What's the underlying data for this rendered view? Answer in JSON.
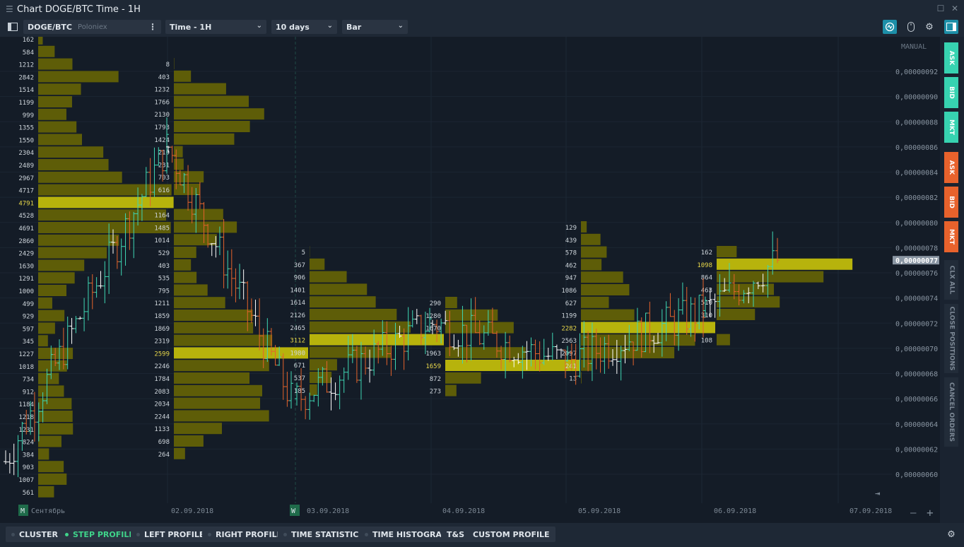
{
  "window": {
    "title": "Chart DOGE/BTC Time - 1H"
  },
  "toolbar": {
    "symbol": "DOGE/BTC",
    "exchange": "Poloniex",
    "timeframe": "Time - 1H",
    "range": "10 days",
    "chart_type": "Bar"
  },
  "price_axis": {
    "mode": "MANUAL",
    "labels": [
      "0,00000092",
      "0,00000090",
      "0,00000088",
      "0,00000086",
      "0,00000084",
      "0,00000082",
      "0,00000080",
      "0,00000078",
      "0,00000076",
      "0,00000074",
      "0,00000072",
      "0,00000070",
      "0,00000068",
      "0,00000066",
      "0,00000064",
      "0,00000062",
      "0,00000060"
    ],
    "current_price": "0,00000077"
  },
  "time_axis": {
    "month_marker": "M",
    "month_label": "Сентябрь",
    "week_marker": "W",
    "dates": [
      "02.09.2018",
      "03.09.2018",
      "04.09.2018",
      "05.09.2018",
      "06.09.2018",
      "07.09.2018"
    ]
  },
  "profiles": [
    {
      "values": [
        "162",
        "584",
        "1212",
        "2842",
        "1514",
        "1199",
        "999",
        "1355",
        "1550",
        "2304",
        "2489",
        "2967",
        "4717",
        "4791",
        "4528",
        "4691",
        "2860",
        "2429",
        "1630",
        "1291",
        "1000",
        "499",
        "929",
        "597",
        "345",
        "1227",
        "1018",
        "734",
        "912",
        "1184",
        "1218",
        "1231",
        "824",
        "384",
        "903",
        "1007",
        "561"
      ],
      "poc": "4791"
    },
    {
      "values": [
        "8",
        "403",
        "1232",
        "1766",
        "2130",
        "1793",
        "1424",
        "210",
        "231",
        "703",
        "616",
        "",
        "1164",
        "1485",
        "1014",
        "529",
        "403",
        "535",
        "795",
        "1211",
        "1859",
        "1869",
        "2319",
        "2599",
        "2246",
        "1784",
        "2083",
        "2034",
        "2244",
        "1133",
        "698",
        "264"
      ],
      "poc": "2599"
    },
    {
      "values": [
        "5",
        "367",
        "906",
        "1401",
        "1614",
        "2126",
        "2465",
        "3112",
        "1980",
        "671",
        "537",
        "185"
      ],
      "poc": "3112"
    },
    {
      "values": [
        "290",
        "1280",
        "1670",
        "",
        "1963",
        "1659",
        "872",
        "273"
      ],
      "poc": "1659"
    },
    {
      "values": [
        "129",
        "439",
        "578",
        "462",
        "947",
        "1086",
        "627",
        "1199",
        "2282",
        "2563",
        "2097",
        "241",
        "13"
      ],
      "poc": "2282"
    },
    {
      "values": [
        "162",
        "1098",
        "864",
        "463",
        "510",
        "310",
        "",
        "108"
      ],
      "poc": "1098"
    }
  ],
  "right_panel": {
    "buttons": [
      "ASK",
      "BID",
      "MKT",
      "ASK",
      "BID",
      "MKT"
    ],
    "labels": [
      "CLX ALL",
      "CLOSE POSITIONS",
      "CANCEL ORDERS"
    ]
  },
  "bottom_tabs": [
    "CLUSTER",
    "STEP PROFILE",
    "LEFT PROFILE",
    "RIGHT PROFILE",
    "TIME STATISTICS",
    "TIME HISTOGRAM",
    "T&S",
    "CUSTOM PROFILE"
  ],
  "colors": {
    "bg": "#141c27",
    "profile": "#5e5d08",
    "poc": "#b7b30c",
    "bull": "#3fd7b4",
    "bear": "#e4632c",
    "neutral": "#ffffff",
    "buy": "#37d3b1",
    "sell": "#e8622c"
  }
}
